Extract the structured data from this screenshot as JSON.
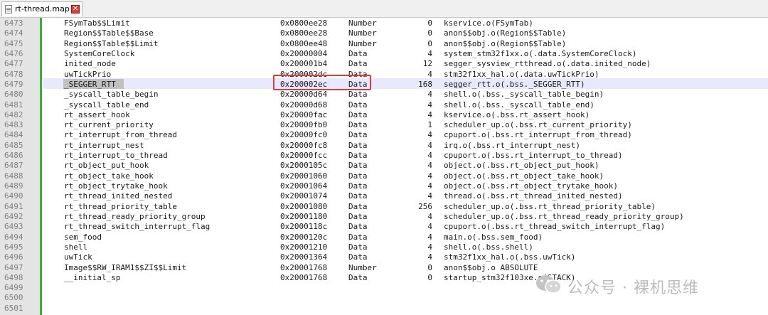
{
  "tab": {
    "title": "rt-thread.map",
    "close_label": "✕"
  },
  "rows": [
    {
      "ln": "6473",
      "sym": "FSymTab$$Limit",
      "addr": "0x0800ee28",
      "type": "Number",
      "size": "0",
      "obj": "kservice.o(FSymTab)"
    },
    {
      "ln": "6474",
      "sym": "Region$$Table$$Base",
      "addr": "0x0800ee28",
      "type": "Number",
      "size": "0",
      "obj": "anon$$obj.o(Region$$Table)"
    },
    {
      "ln": "6475",
      "sym": "Region$$Table$$Limit",
      "addr": "0x0800ee48",
      "type": "Number",
      "size": "0",
      "obj": "anon$$obj.o(Region$$Table)"
    },
    {
      "ln": "6476",
      "sym": "SystemCoreClock",
      "addr": "0x20000004",
      "type": "Data",
      "size": "4",
      "obj": "system_stm32f1xx.o(.data.SystemCoreClock)"
    },
    {
      "ln": "6477",
      "sym": "inited_node",
      "addr": "0x200001b4",
      "type": "Data",
      "size": "12",
      "obj": "segger_sysview_rtthread.o(.data.inited_node)"
    },
    {
      "ln": "6478",
      "sym": "uwTickPrio",
      "addr": "0x200002dc",
      "type": "Data",
      "size": "4",
      "obj": "stm32f1xx_hal.o(.data.uwTickPrio)"
    },
    {
      "ln": "6479",
      "sym": "_SEGGER_RTT",
      "addr": "0x200002ec",
      "type": "Data",
      "size": "168",
      "obj": "segger_rtt.o(.bss._SEGGER_RTT)"
    },
    {
      "ln": "6480",
      "sym": "_syscall_table_begin",
      "addr": "0x20000d64",
      "type": "Data",
      "size": "4",
      "obj": "shell.o(.bss._syscall_table_begin)"
    },
    {
      "ln": "6481",
      "sym": "_syscall_table_end",
      "addr": "0x20000d68",
      "type": "Data",
      "size": "4",
      "obj": "shell.o(.bss._syscall_table_end)"
    },
    {
      "ln": "6482",
      "sym": "rt_assert_hook",
      "addr": "0x20000fac",
      "type": "Data",
      "size": "4",
      "obj": "kservice.o(.bss.rt_assert_hook)"
    },
    {
      "ln": "6483",
      "sym": "rt_current_priority",
      "addr": "0x20000fb0",
      "type": "Data",
      "size": "1",
      "obj": "scheduler_up.o(.bss.rt_current_priority)"
    },
    {
      "ln": "6484",
      "sym": "rt_interrupt_from_thread",
      "addr": "0x20000fc0",
      "type": "Data",
      "size": "4",
      "obj": "cpuport.o(.bss.rt_interrupt_from_thread)"
    },
    {
      "ln": "6485",
      "sym": "rt_interrupt_nest",
      "addr": "0x20000fc8",
      "type": "Data",
      "size": "4",
      "obj": "irq.o(.bss.rt_interrupt_nest)"
    },
    {
      "ln": "6486",
      "sym": "rt_interrupt_to_thread",
      "addr": "0x20000fcc",
      "type": "Data",
      "size": "4",
      "obj": "cpuport.o(.bss.rt_interrupt_to_thread)"
    },
    {
      "ln": "6487",
      "sym": "rt_object_put_hook",
      "addr": "0x2000105c",
      "type": "Data",
      "size": "4",
      "obj": "object.o(.bss.rt_object_put_hook)"
    },
    {
      "ln": "6488",
      "sym": "rt_object_take_hook",
      "addr": "0x20001060",
      "type": "Data",
      "size": "4",
      "obj": "object.o(.bss.rt_object_take_hook)"
    },
    {
      "ln": "6489",
      "sym": "rt_object_trytake_hook",
      "addr": "0x20001064",
      "type": "Data",
      "size": "4",
      "obj": "object.o(.bss.rt_object_trytake_hook)"
    },
    {
      "ln": "6490",
      "sym": "rt_thread_inited_nested",
      "addr": "0x20001074",
      "type": "Data",
      "size": "4",
      "obj": "thread.o(.bss.rt_thread_inited_nested)"
    },
    {
      "ln": "6491",
      "sym": "rt_thread_priority_table",
      "addr": "0x20001080",
      "type": "Data",
      "size": "256",
      "obj": "scheduler_up.o(.bss.rt_thread_priority_table)"
    },
    {
      "ln": "6492",
      "sym": "rt_thread_ready_priority_group",
      "addr": "0x20001180",
      "type": "Data",
      "size": "4",
      "obj": "scheduler_up.o(.bss.rt_thread_ready_priority_group)"
    },
    {
      "ln": "6493",
      "sym": "rt_thread_switch_interrupt_flag",
      "addr": "0x2000118c",
      "type": "Data",
      "size": "4",
      "obj": "cpuport.o(.bss.rt_thread_switch_interrupt_flag)"
    },
    {
      "ln": "6494",
      "sym": "sem_food",
      "addr": "0x2000120c",
      "type": "Data",
      "size": "4",
      "obj": "main.o(.bss.sem_food)"
    },
    {
      "ln": "6495",
      "sym": "shell",
      "addr": "0x20001210",
      "type": "Data",
      "size": "4",
      "obj": "shell.o(.bss.shell)"
    },
    {
      "ln": "6496",
      "sym": "uwTick",
      "addr": "0x20001364",
      "type": "Data",
      "size": "4",
      "obj": "stm32f1xx_hal.o(.bss.uwTick)"
    },
    {
      "ln": "6497",
      "sym": "Image$$RW_IRAM1$$ZI$$Limit",
      "addr": "0x20001768",
      "type": "Number",
      "size": "0",
      "obj": "anon$$obj.o ABSOLUTE"
    },
    {
      "ln": "6498",
      "sym": "__initial_sp",
      "addr": "0x20001768",
      "type": "Data",
      "size": "0",
      "obj": "startup_stm32f103xe.o(STACK)"
    },
    {
      "ln": "6499",
      "sym": "",
      "addr": "",
      "type": "",
      "size": "",
      "obj": ""
    },
    {
      "ln": "6500",
      "sym": "",
      "addr": "",
      "type": "",
      "size": "",
      "obj": ""
    },
    {
      "ln": "6501",
      "sym": "",
      "addr": "",
      "type": "",
      "size": "",
      "obj": ""
    }
  ],
  "highlight_color": "#e33b3b",
  "accent_green": "#32b432",
  "watermark": {
    "text": "公众号 · 裸机思维",
    "icon": "wechat-logo-icon"
  }
}
